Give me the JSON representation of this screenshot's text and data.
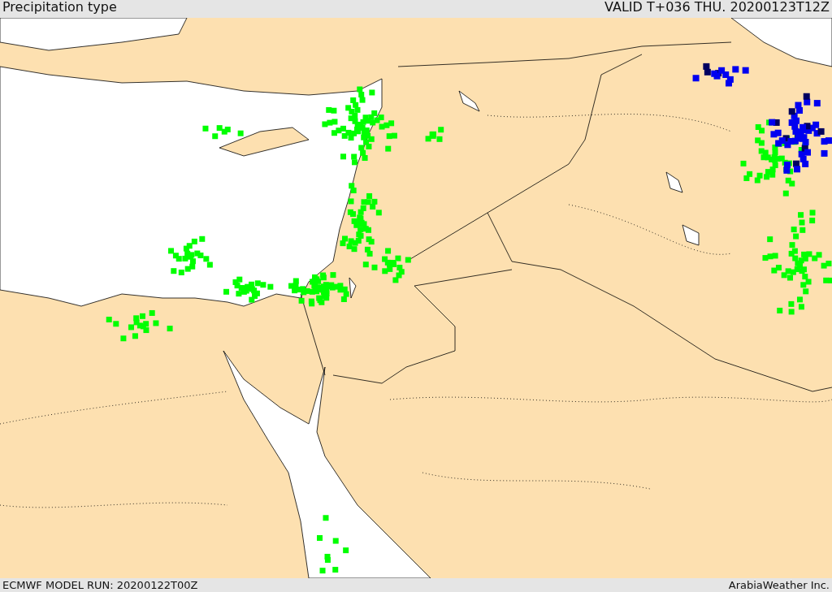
{
  "header": {
    "title": "Precipitation type",
    "valid_time": "VALID T+036 THU. 20200123T12Z"
  },
  "footer": {
    "model_run": "ECMWF MODEL RUN: 20200122T00Z",
    "credit": "ArabiaWeather Inc."
  }
}
